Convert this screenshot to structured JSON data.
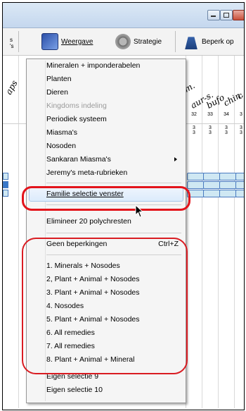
{
  "toolbar": {
    "left_cut_label_1": "s",
    "left_cut_label_2": "'s",
    "weergave": "Weergave",
    "strategie": "Strategie",
    "beperk_op": "Beperk op"
  },
  "columns": {
    "headers": [
      "aps",
      "m.",
      "aur-s.",
      "bufo",
      "chin.",
      "c"
    ],
    "numbers": [
      "32",
      "33",
      "34",
      "3"
    ],
    "counts": [
      "3",
      "3",
      "3",
      "3"
    ]
  },
  "menu": {
    "items": [
      {
        "label": "Mineralen + imponderabelen",
        "disabled": false
      },
      {
        "label": "Planten",
        "disabled": false
      },
      {
        "label": "Dieren",
        "disabled": false
      },
      {
        "label": "Kingdoms indeling",
        "disabled": true
      },
      {
        "label": "Periodiek systeem",
        "disabled": false
      },
      {
        "label": "Miasma's",
        "disabled": false
      },
      {
        "label": "Nosoden",
        "disabled": false
      },
      {
        "label": "Sankaran Miasma's",
        "disabled": false,
        "submenu": true
      },
      {
        "label": "Jeremy's meta-rubrieken",
        "disabled": false
      }
    ],
    "familie": "Familie selectie venster",
    "elimineer": "Elimineer 20 polychresten",
    "geen": {
      "label": "Geen beperkingen",
      "shortcut": "Ctrl+Z"
    },
    "presets": [
      "1. Minerals + Nosodes",
      "2, Plant + Animal + Nosodes",
      "3. Plant + Animal + Nosodes",
      "4. Nosodes",
      "5. Plant + Animal + Nosodes",
      "6. All remedies",
      "7. All remedies",
      "8. Plant + Animal + Mineral"
    ],
    "eigen": [
      "Eigen selectie 9",
      "Eigen selectie 10"
    ]
  },
  "colors": {
    "highlight_ring": "#e3141b",
    "selection": "#dcebfc"
  }
}
